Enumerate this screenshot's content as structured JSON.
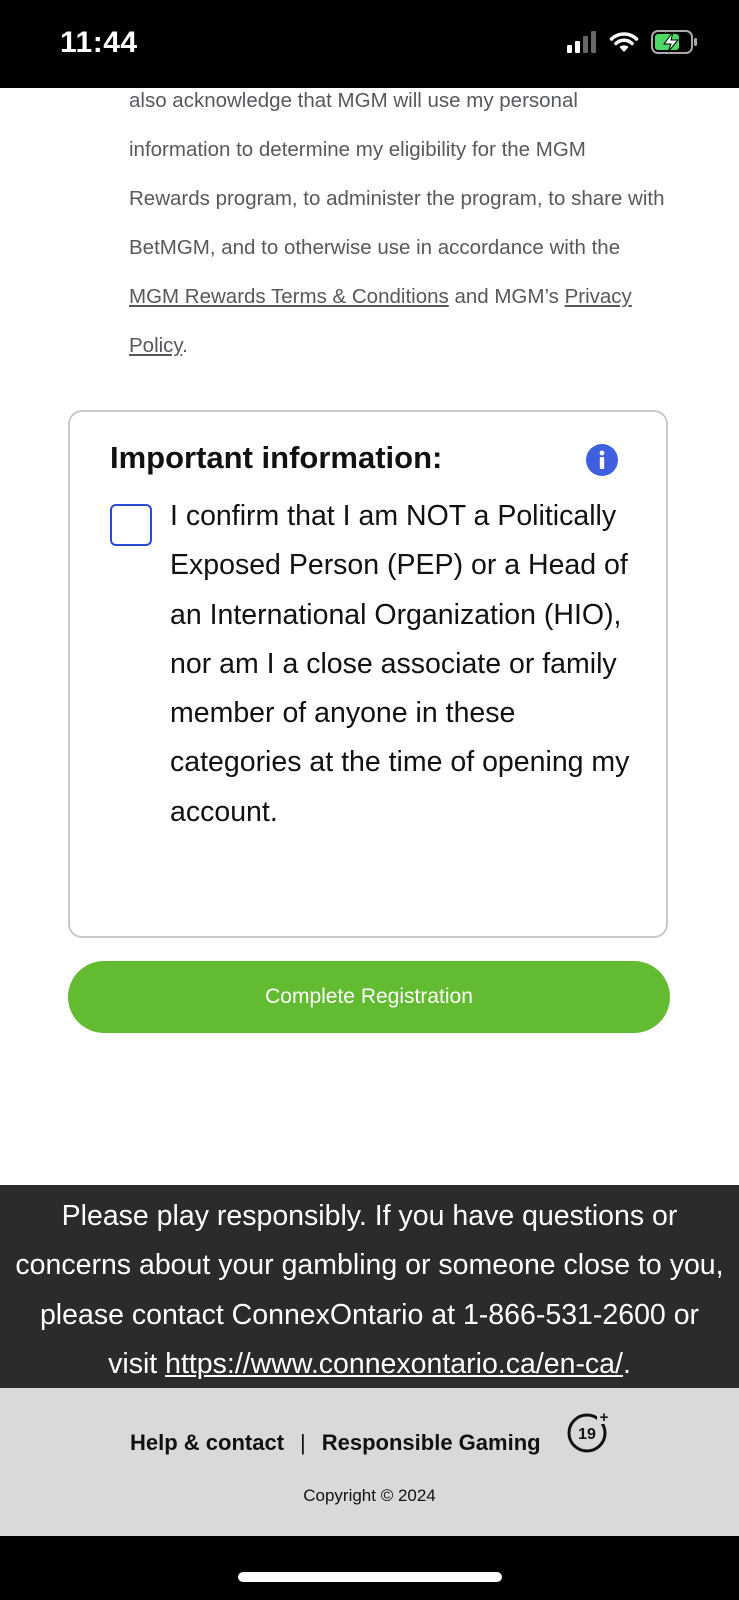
{
  "status_bar": {
    "time": "11:44"
  },
  "consent": {
    "text_before": "also acknowledge that MGM will use my personal information to determine my eligibility for the MGM Rewards program, to administer the program, to share with BetMGM, and to otherwise use in accordance with the ",
    "terms_link": "MGM Rewards Terms & Conditions",
    "text_middle": " and MGM’s ",
    "privacy_link": "Privacy Policy",
    "text_after": "."
  },
  "important_info": {
    "title": "Important information:",
    "confirm_text": "I confirm that I am NOT a Politically Exposed Person (PEP) or a Head of an International Organization (HIO), nor am I a close associate or family member of anyone in these categories at the time of opening my account."
  },
  "actions": {
    "complete_registration": "Complete Registration"
  },
  "responsible_gaming_banner": {
    "text": "Please play responsibly. If you have questions or concerns about your gambling or someone close to you, please contact ConnexOntario at 1-866-531-2600 or visit ",
    "link": "https://www.connexontario.ca/en-ca/",
    "text_after": "."
  },
  "footer": {
    "help_link": "Help & contact",
    "separator": "|",
    "responsible_gaming_link": "Responsible Gaming",
    "age_badge": "19+",
    "copyright": "Copyright © 2024"
  },
  "colors": {
    "accent_green": "#62bb30",
    "info_blue": "#3f5fe0",
    "checkbox_border": "#2a49d6",
    "banner_bg": "#2b2b2b",
    "footer_bg": "#d9d9d9"
  },
  "icons": [
    "signal-icon",
    "wifi-icon",
    "battery-charging-icon",
    "info-icon",
    "age-19-plus-icon"
  ]
}
